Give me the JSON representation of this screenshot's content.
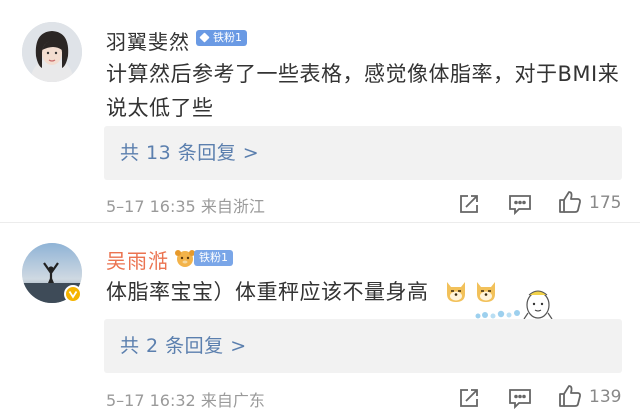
{
  "comments": [
    {
      "username": "羽翼斐然",
      "fan_badge": "铁粉1",
      "text": "计算然后参考了一些表格，感觉像体脂率，对于BMI来说太低了些",
      "replies_label": "共 13 条回复 >",
      "meta": "5–17 16:35  来自浙江",
      "likes": "175"
    },
    {
      "username": "吴雨湉",
      "fan_badge": "铁粉1",
      "text": "体脂率宝宝）体重秤应该不量身高",
      "replies_label": "共 2 条回复 >",
      "meta": "5–17 16:32  来自广东",
      "likes": "139"
    }
  ],
  "colors": {
    "username": "#333333",
    "username_highlight": "#eb7350",
    "link": "#5b7fae",
    "meta": "#9a9a9a",
    "reply_bg": "#f2f2f2"
  },
  "icons": [
    "share-icon",
    "comment-icon",
    "like-icon",
    "verified-badge-icon",
    "dog-emoji-icon",
    "sticker-icon"
  ]
}
